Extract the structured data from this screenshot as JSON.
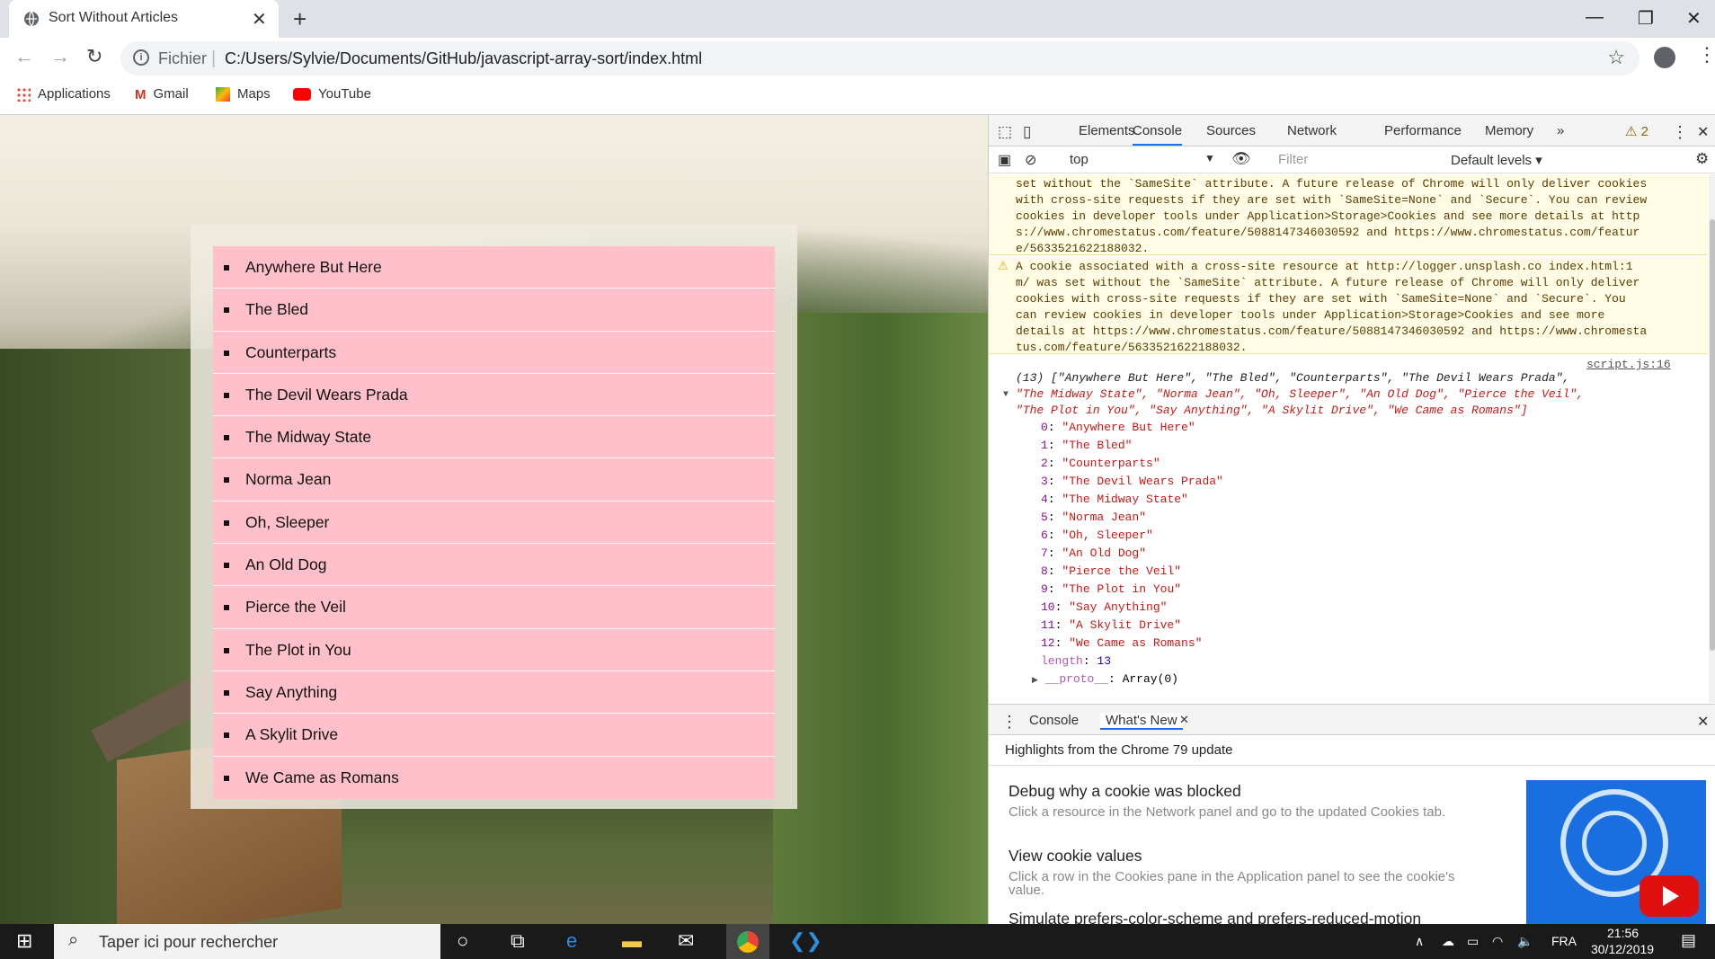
{
  "tab": {
    "title": "Sort Without Articles",
    "close": "✕",
    "new": "+"
  },
  "window": {
    "minimize": "—",
    "maximize": "❐",
    "close": "✕"
  },
  "address": {
    "scheme_label": "Fichier",
    "separator": "|",
    "url": "C:/Users/Sylvie/Documents/GitHub/javascript-array-sort/index.html"
  },
  "bookmarks": [
    {
      "label": "Applications"
    },
    {
      "label": "Gmail"
    },
    {
      "label": "Maps"
    },
    {
      "label": "YouTube"
    }
  ],
  "list": [
    "Anywhere But Here",
    "The Bled",
    "Counterparts",
    "The Devil Wears Prada",
    "The Midway State",
    "Norma Jean",
    "Oh, Sleeper",
    "An Old Dog",
    "Pierce the Veil",
    "The Plot in You",
    "Say Anything",
    "A Skylit Drive",
    "We Came as Romans"
  ],
  "devtools": {
    "tabs": [
      "Elements",
      "Console",
      "Sources",
      "Network",
      "Performance",
      "Memory",
      "»"
    ],
    "warning_count": "⚠ 2",
    "context": "top",
    "filter_placeholder": "Filter",
    "levels": "Default levels ▾",
    "warn1_lines": [
      "set without the `SameSite` attribute. A future release of Chrome will only deliver cookies",
      "with cross-site requests if they are set with `SameSite=None` and `Secure`. You can review",
      "cookies in developer tools under Application>Storage>Cookies and see more details at http",
      "s://www.chromestatus.com/feature/5088147346030592 and https://www.chromestatus.com/featur",
      "e/5633521622188032."
    ],
    "warn2_lines": [
      "A cookie associated with a cross-site resource at http://logger.unsplash.co  index.html:1",
      "m/ was set without the `SameSite` attribute. A future release of Chrome will only deliver",
      "cookies with cross-site requests if they are set with `SameSite=None` and `Secure`. You",
      "can review cookies in developer tools under Application>Storage>Cookies and see more",
      "details at https://www.chromestatus.com/feature/5088147346030592 and https://www.chromesta",
      "tus.com/feature/5633521622188032."
    ],
    "source_link": "script.js:16",
    "array_summary": [
      "(13) [\"Anywhere But Here\", \"The Bled\", \"Counterparts\", \"The Devil Wears Prada\",",
      "\"The Midway State\", \"Norma Jean\", \"Oh, Sleeper\", \"An Old Dog\", \"Pierce the Veil\",",
      "\"The Plot in You\", \"Say Anything\", \"A Skylit Drive\", \"We Came as Romans\"]"
    ],
    "array_entries": [
      {
        "k": "0",
        "v": "\"Anywhere But Here\""
      },
      {
        "k": "1",
        "v": "\"The Bled\""
      },
      {
        "k": "2",
        "v": "\"Counterparts\""
      },
      {
        "k": "3",
        "v": "\"The Devil Wears Prada\""
      },
      {
        "k": "4",
        "v": "\"The Midway State\""
      },
      {
        "k": "5",
        "v": "\"Norma Jean\""
      },
      {
        "k": "6",
        "v": "\"Oh, Sleeper\""
      },
      {
        "k": "7",
        "v": "\"An Old Dog\""
      },
      {
        "k": "8",
        "v": "\"Pierce the Veil\""
      },
      {
        "k": "9",
        "v": "\"The Plot in You\""
      },
      {
        "k": "10",
        "v": "\"Say Anything\""
      },
      {
        "k": "11",
        "v": "\"A Skylit Drive\""
      },
      {
        "k": "12",
        "v": "\"We Came as Romans\""
      }
    ],
    "length_key": "length",
    "length_val": "13",
    "proto_key": "__proto__",
    "proto_val": "Array(0)",
    "drawer_tabs": [
      "Console",
      "What's New"
    ],
    "whatsnew_header": "Highlights from the Chrome 79 update",
    "whatsnew_items": [
      {
        "title": "Debug why a cookie was blocked",
        "desc": "Click a resource in the Network panel and go to the updated Cookies tab."
      },
      {
        "title": "View cookie values",
        "desc": "Click a row in the Cookies pane in the Application panel to see the cookie's value."
      },
      {
        "title": "Simulate prefers-color-scheme and prefers-reduced-motion",
        "desc": ""
      }
    ]
  },
  "taskbar": {
    "search_placeholder": "Taper ici pour rechercher",
    "lang": "FRA",
    "time": "21:56",
    "date": "30/12/2019"
  },
  "colors": {
    "list_bg": "#ffc0cb",
    "tab_active": "#1a73e8",
    "warn_bg": "#fffbe5"
  }
}
